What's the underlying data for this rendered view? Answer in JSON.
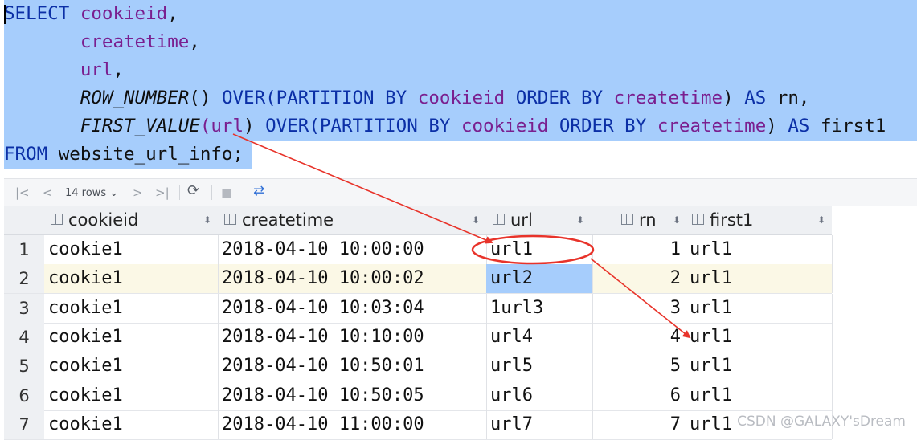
{
  "sql": {
    "l1": {
      "kw": "SELECT",
      "col": "cookieid",
      "rest": ","
    },
    "l2": {
      "col": "createtime",
      "rest": ","
    },
    "l3": {
      "col": "url",
      "rest": ","
    },
    "l4": {
      "fn": "ROW_NUMBER",
      "p1": "() ",
      "kw1": "OVER",
      "p2": "(",
      "kw2": "PARTITION BY",
      "col1": "cookieid",
      "kw3": "ORDER BY",
      "col2": "createtime",
      "p3": ") ",
      "kw4": "AS",
      "alias": "rn,"
    },
    "l5": {
      "fn": "FIRST_VALUE",
      "p1": "(",
      "arg": "url",
      "p2": ") ",
      "kw1": "OVER",
      "p3": "(",
      "kw2": "PARTITION BY",
      "col1": "cookieid",
      "kw3": "ORDER BY",
      "col2": "createtime",
      "p4": ") ",
      "kw4": "AS",
      "alias": "first1"
    },
    "l6": {
      "kw": "FROM",
      "table": "website_url_info;"
    }
  },
  "toolbar": {
    "first_icon": "|<",
    "prev_icon": "<",
    "rows_label": "14 rows",
    "next_icon": ">",
    "last_icon": ">|",
    "refresh_icon": "⟳",
    "stop_icon": "■",
    "compare_icon": "⇄"
  },
  "grid": {
    "columns": [
      "cookieid",
      "createtime",
      "url",
      "rn",
      "first1"
    ],
    "sort_icon": "⬍",
    "rows": [
      {
        "n": "1",
        "cookieid": "cookie1",
        "createtime": "2018-04-10 10:00:00",
        "url": "url1",
        "rn": "1",
        "first1": "url1"
      },
      {
        "n": "2",
        "cookieid": "cookie1",
        "createtime": "2018-04-10 10:00:02",
        "url": "url2",
        "rn": "2",
        "first1": "url1"
      },
      {
        "n": "3",
        "cookieid": "cookie1",
        "createtime": "2018-04-10 10:03:04",
        "url": "1url3",
        "rn": "3",
        "first1": "url1"
      },
      {
        "n": "4",
        "cookieid": "cookie1",
        "createtime": "2018-04-10 10:10:00",
        "url": "url4",
        "rn": "4",
        "first1": "url1"
      },
      {
        "n": "5",
        "cookieid": "cookie1",
        "createtime": "2018-04-10 10:50:01",
        "url": "url5",
        "rn": "5",
        "first1": "url1"
      },
      {
        "n": "6",
        "cookieid": "cookie1",
        "createtime": "2018-04-10 10:50:05",
        "url": "url6",
        "rn": "6",
        "first1": "url1"
      },
      {
        "n": "7",
        "cookieid": "cookie1",
        "createtime": "2018-04-10 11:00:00",
        "url": "url7",
        "rn": "7",
        "first1": "url1"
      }
    ]
  },
  "watermark": "CSDN @GALAXY'sDream",
  "colors": {
    "selection": "#a6cdfc",
    "keyword": "#0b2fa6",
    "column": "#7a1f8f",
    "annotation": "#e8332a"
  }
}
